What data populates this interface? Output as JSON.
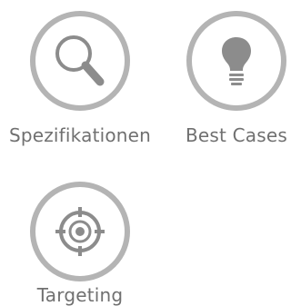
{
  "tiles": [
    {
      "label": "Spezifikationen",
      "icon": "search-icon"
    },
    {
      "label": "Best Cases",
      "icon": "lightbulb-icon"
    },
    {
      "label": "Targeting",
      "icon": "crosshair-icon"
    }
  ],
  "colors": {
    "ring": "#b4b4b4",
    "icon_fill": "#8c8c8c",
    "label": "#707070"
  }
}
